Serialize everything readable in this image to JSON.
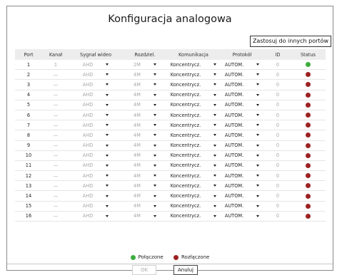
{
  "title": "Konfiguracja analogowa",
  "apply_button": "Zastosuj do innych portów",
  "columns": [
    "Port",
    "Kanał",
    "Sygnał wideo",
    "Rozdziel.",
    "Komunikacja",
    "Protokół",
    "ID",
    "Status"
  ],
  "rows": [
    {
      "port": "1",
      "kanal": "1",
      "sygnal": "AHD",
      "rozdz": "2M",
      "kom": "Koncentrycz.",
      "prot": "AUTOM.",
      "id": "0",
      "status": "connected"
    },
    {
      "port": "2",
      "kanal": "—",
      "sygnal": "AHD",
      "rozdz": "4M",
      "kom": "Koncentrycz.",
      "prot": "AUTOM.",
      "id": "0",
      "status": "disconnected"
    },
    {
      "port": "3",
      "kanal": "—",
      "sygnal": "AHD",
      "rozdz": "4M",
      "kom": "Koncentrycz.",
      "prot": "AUTOM.",
      "id": "0",
      "status": "disconnected"
    },
    {
      "port": "4",
      "kanal": "—",
      "sygnal": "AHD",
      "rozdz": "4M",
      "kom": "Koncentrycz.",
      "prot": "AUTOM.",
      "id": "0",
      "status": "disconnected"
    },
    {
      "port": "5",
      "kanal": "—",
      "sygnal": "AHD",
      "rozdz": "4M",
      "kom": "Koncentrycz.",
      "prot": "AUTOM.",
      "id": "0",
      "status": "disconnected"
    },
    {
      "port": "6",
      "kanal": "—",
      "sygnal": "AHD",
      "rozdz": "4M",
      "kom": "Koncentrycz.",
      "prot": "AUTOM.",
      "id": "0",
      "status": "disconnected"
    },
    {
      "port": "7",
      "kanal": "—",
      "sygnal": "AHD",
      "rozdz": "4M",
      "kom": "Koncentrycz.",
      "prot": "AUTOM.",
      "id": "0",
      "status": "disconnected"
    },
    {
      "port": "8",
      "kanal": "—",
      "sygnal": "AHD",
      "rozdz": "4M",
      "kom": "Koncentrycz.",
      "prot": "AUTOM.",
      "id": "0",
      "status": "disconnected"
    },
    {
      "port": "9",
      "kanal": "—",
      "sygnal": "AHD",
      "rozdz": "4M",
      "kom": "Koncentrycz.",
      "prot": "AUTOM.",
      "id": "0",
      "status": "disconnected"
    },
    {
      "port": "10",
      "kanal": "—",
      "sygnal": "AHD",
      "rozdz": "4M",
      "kom": "Koncentrycz.",
      "prot": "AUTOM.",
      "id": "0",
      "status": "disconnected"
    },
    {
      "port": "11",
      "kanal": "—",
      "sygnal": "AHD",
      "rozdz": "4M",
      "kom": "Koncentrycz.",
      "prot": "AUTOM.",
      "id": "0",
      "status": "disconnected"
    },
    {
      "port": "12",
      "kanal": "—",
      "sygnal": "AHD",
      "rozdz": "4M",
      "kom": "Koncentrycz.",
      "prot": "AUTOM.",
      "id": "0",
      "status": "disconnected"
    },
    {
      "port": "13",
      "kanal": "—",
      "sygnal": "AHD",
      "rozdz": "4M",
      "kom": "Koncentrycz.",
      "prot": "AUTOM.",
      "id": "0",
      "status": "disconnected"
    },
    {
      "port": "14",
      "kanal": "—",
      "sygnal": "AHD",
      "rozdz": "4M",
      "kom": "Koncentrycz.",
      "prot": "AUTOM.",
      "id": "0",
      "status": "disconnected"
    },
    {
      "port": "15",
      "kanal": "—",
      "sygnal": "AHD",
      "rozdz": "4M",
      "kom": "Koncentrycz.",
      "prot": "AUTOM.",
      "id": "0",
      "status": "disconnected"
    },
    {
      "port": "16",
      "kanal": "—",
      "sygnal": "AHD",
      "rozdz": "4M",
      "kom": "Koncentrycz.",
      "prot": "AUTOM.",
      "id": "0",
      "status": "disconnected"
    }
  ],
  "legend": {
    "connected": "Połączone",
    "disconnected": "Rozłączone"
  },
  "colors": {
    "connected": "#3cae3c",
    "disconnected": "#9c2222"
  },
  "buttons": {
    "ok": "OK",
    "cancel": "Anuluj"
  }
}
